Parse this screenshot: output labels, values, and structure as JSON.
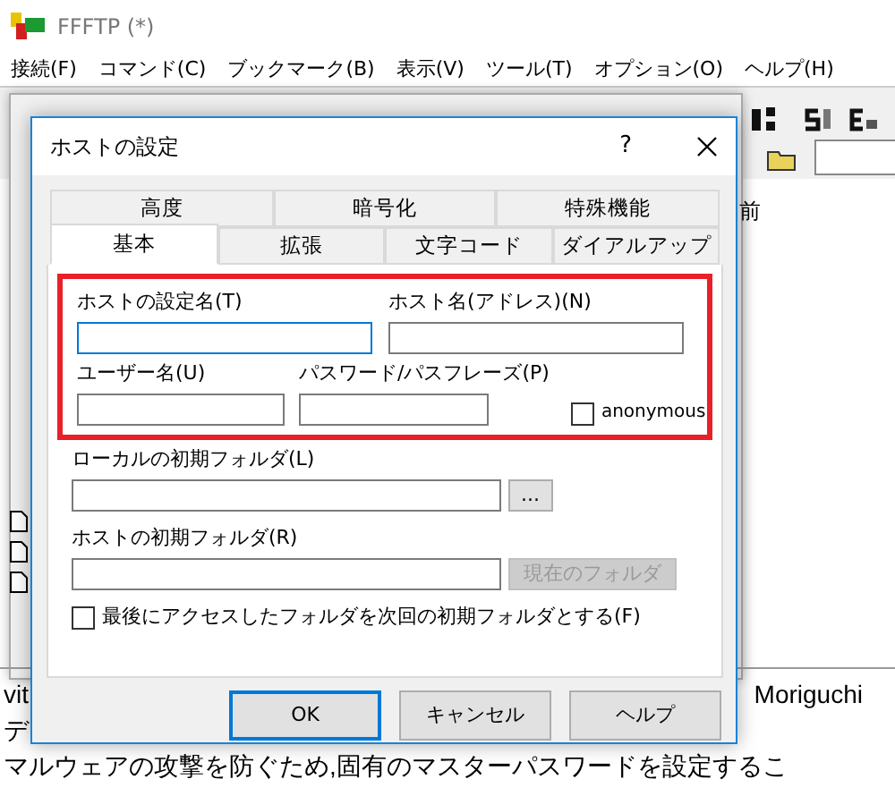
{
  "app_window": {
    "title": "FFFTP (*)",
    "menu": [
      "接続(F)",
      "コマンド(C)",
      "ブックマーク(B)",
      "表示(V)",
      "ツール(T)",
      "オプション(O)",
      "ヘルプ(H)"
    ],
    "column_header_fragment": "前",
    "log_lines": [
      {
        "left": "vit",
        "right": "Moriguchi"
      },
      {
        "left": "デ"
      },
      {
        "left": "マルウェアの攻撃を防ぐため,固有のマスターパスワードを設定するこ"
      }
    ]
  },
  "dialog": {
    "title": "ホストの設定",
    "help_glyph": "?",
    "tab_rows": [
      [
        {
          "label": "高度",
          "selected": false
        },
        {
          "label": "暗号化",
          "selected": false
        },
        {
          "label": "特殊機能",
          "selected": false
        }
      ],
      [
        {
          "label": "基本",
          "selected": true
        },
        {
          "label": "拡張",
          "selected": false
        },
        {
          "label": "文字コード",
          "selected": false
        },
        {
          "label": "ダイアルアップ",
          "selected": false
        }
      ]
    ],
    "host_setting_name": {
      "label": "ホストの設定名(T)",
      "focused": true
    },
    "host_name": {
      "label": "ホスト名(アドレス)(N)",
      "focused": false
    },
    "user_name": {
      "label": "ユーザー名(U)",
      "focused": false
    },
    "password": {
      "label": "パスワード/パスフレーズ(P)",
      "focused": false
    },
    "anonymous": {
      "label": "anonymous",
      "checked": false
    },
    "local_folder": {
      "label": "ローカルの初期フォルダ(L)",
      "browse_button": "..."
    },
    "host_folder": {
      "label": "ホストの初期フォルダ(R)",
      "current_button": {
        "label": "現在のフォルダ",
        "disabled": true
      }
    },
    "last_folder": {
      "label": "最後にアクセスしたフォルダを次回の初期フォルダとする(F)",
      "checked": false
    },
    "buttons": [
      {
        "label": "OK",
        "default": true
      },
      {
        "label": "キャンセル",
        "default": false
      },
      {
        "label": "ヘルプ",
        "default": false
      }
    ]
  }
}
